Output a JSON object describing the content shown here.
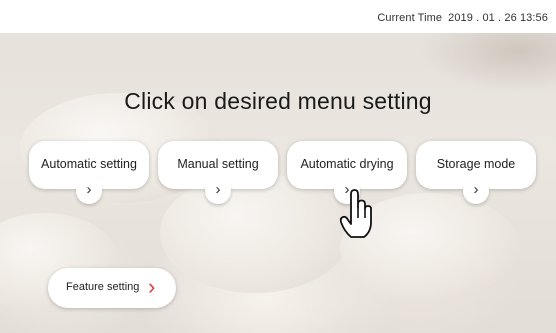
{
  "status_bar": {
    "clock_label": "Current Time",
    "clock_value": "2019 . 01 . 26  13:56"
  },
  "main": {
    "heading": "Click on desired menu setting",
    "menu_items": [
      {
        "label": "Automatic setting",
        "icon": "chevron-right-icon"
      },
      {
        "label": "Manual setting",
        "icon": "chevron-right-icon"
      },
      {
        "label": "Automatic drying",
        "icon": "chevron-right-icon"
      },
      {
        "label": "Storage mode",
        "icon": "chevron-right-icon"
      }
    ],
    "pointer_icon": "hand-pointer-icon",
    "feature_button": {
      "label": "Feature setting",
      "icon": "chevron-right-icon"
    }
  },
  "colors": {
    "accent": "#e03c3c",
    "card_bg": "#ffffff",
    "text": "#222222"
  }
}
